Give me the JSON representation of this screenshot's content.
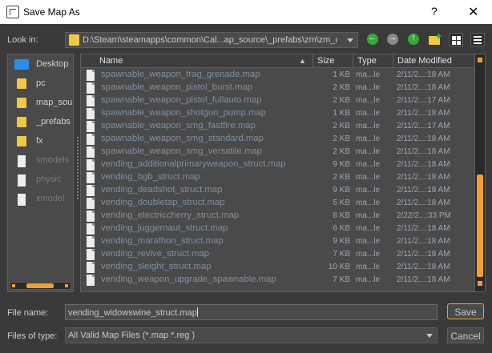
{
  "window": {
    "title": "Save Map As",
    "help_glyph": "?",
    "close_glyph": "✕"
  },
  "toolbar": {
    "look_in_label": "Look in:",
    "path": "D:\\Steam\\steamapps\\common\\Cal...ap_source\\_prefabs\\zm\\zm_core",
    "back_icon": "back-arrow-icon",
    "forward_icon": "forward-arrow-icon",
    "up_icon": "up-arrow-icon",
    "new_folder_icon": "new-folder-icon",
    "view_icons": [
      "grid-view-icon",
      "list-view-icon"
    ]
  },
  "sidebar": {
    "items": [
      {
        "label": "Desktop",
        "icon": "desktop-icon",
        "enabled": true
      },
      {
        "label": "pc",
        "icon": "folder-icon",
        "enabled": true
      },
      {
        "label": "map_source",
        "icon": "folder-icon",
        "enabled": true
      },
      {
        "label": "_prefabs",
        "icon": "folder-icon",
        "enabled": true
      },
      {
        "label": "fx",
        "icon": "folder-icon",
        "enabled": true
      },
      {
        "label": "smodels",
        "icon": "file-icon",
        "enabled": false
      },
      {
        "label": "physic",
        "icon": "file-icon",
        "enabled": false
      },
      {
        "label": "xmodel",
        "icon": "file-icon",
        "enabled": false
      }
    ]
  },
  "filelist": {
    "columns": {
      "name": "Name",
      "size": "Size",
      "type": "Type",
      "date": "Date Modified"
    },
    "sort_column": "Name",
    "rows": [
      {
        "name": "spawnable_weapon_frag_grenade.map",
        "size": "1 KB",
        "type": "ma...le",
        "date": "2/11/2...:18 AM"
      },
      {
        "name": "spawnable_weapon_pistol_burst.map",
        "size": "2 KB",
        "type": "ma...le",
        "date": "2/11/2...:18 AM"
      },
      {
        "name": "spawnable_weapon_pistol_fullauto.map",
        "size": "2 KB",
        "type": "ma...le",
        "date": "2/11/2...:17 AM"
      },
      {
        "name": "spawnable_weapon_shotgun_pump.map",
        "size": "1 KB",
        "type": "ma...le",
        "date": "2/11/2...:18 AM"
      },
      {
        "name": "spawnable_weapon_smg_fastfire.map",
        "size": "2 KB",
        "type": "ma...le",
        "date": "2/11/2...:17 AM"
      },
      {
        "name": "spawnable_weapon_smg_standard.map",
        "size": "2 KB",
        "type": "ma...le",
        "date": "2/11/2...:18 AM"
      },
      {
        "name": "spawnable_weapon_smg_versatile.map",
        "size": "2 KB",
        "type": "ma...le",
        "date": "2/11/2...:18 AM"
      },
      {
        "name": "vending_additionalprimaryweapon_struct.map",
        "size": "9 KB",
        "type": "ma...le",
        "date": "2/11/2...:18 AM"
      },
      {
        "name": "vending_bgb_struct.map",
        "size": "2 KB",
        "type": "ma...le",
        "date": "2/11/2...:18 AM"
      },
      {
        "name": "vending_deadshot_struct.map",
        "size": "9 KB",
        "type": "ma...le",
        "date": "2/11/2...:18 AM"
      },
      {
        "name": "vending_doubletap_struct.map",
        "size": "5 KB",
        "type": "ma...le",
        "date": "2/11/2...:18 AM"
      },
      {
        "name": "vending_electriccherry_struct.map",
        "size": "8 KB",
        "type": "ma...le",
        "date": "2/22/2...:33 PM"
      },
      {
        "name": "vending_juggernaut_struct.map",
        "size": "6 KB",
        "type": "ma...le",
        "date": "2/11/2...:18 AM"
      },
      {
        "name": "vending_marathon_struct.map",
        "size": "9 KB",
        "type": "ma...le",
        "date": "2/11/2...:18 AM"
      },
      {
        "name": "vending_revive_struct.map",
        "size": "7 KB",
        "type": "ma...le",
        "date": "2/11/2...:18 AM"
      },
      {
        "name": "vending_sleight_struct.map",
        "size": "10 KB",
        "type": "ma...le",
        "date": "2/11/2...:18 AM"
      },
      {
        "name": "vending_weapon_upgrade_spawnable.map",
        "size": "7 KB",
        "type": "ma...le",
        "date": "2/11/2...:18 AM"
      }
    ]
  },
  "footer": {
    "file_name_label": "File name:",
    "file_name_value": "vending_widowswine_struct.map",
    "files_of_type_label": "Files of type:",
    "files_of_type_value": "All Valid Map Files (*.map *.reg )",
    "save_label": "Save",
    "cancel_label": "Cancel"
  },
  "colors": {
    "background": "#3a3a3a",
    "panel": "#4a4a4a",
    "accent": "#f0a030",
    "folder": "#f2c744",
    "nav_green": "#38a838"
  }
}
